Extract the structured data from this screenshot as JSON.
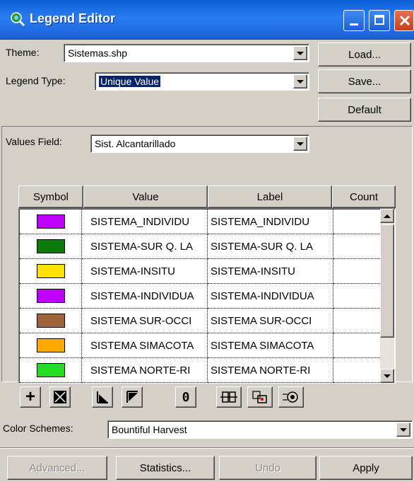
{
  "window": {
    "title": "Legend Editor"
  },
  "theme": {
    "label": "Theme:",
    "value": "Sistemas.shp"
  },
  "legend_type": {
    "label": "Legend Type:",
    "value": "Unique Value"
  },
  "side_buttons": {
    "load": "Load...",
    "save": "Save...",
    "default": "Default"
  },
  "values_field": {
    "label": "Values Field:",
    "value": "Sist. Alcantarillado"
  },
  "table": {
    "headers": [
      "Symbol",
      "Value",
      "Label",
      "Count"
    ],
    "rows": [
      {
        "color": "#c000ff",
        "value": "SISTEMA_INDIVIDU",
        "label": "SISTEMA_INDIVIDU",
        "count": ""
      },
      {
        "color": "#0a7a0a",
        "value": "SISTEMA-SUR Q. LA",
        "label": "SISTEMA-SUR Q. LA",
        "count": ""
      },
      {
        "color": "#ffe000",
        "value": "SISTEMA-INSITU",
        "label": "SISTEMA-INSITU",
        "count": ""
      },
      {
        "color": "#c000ff",
        "value": "SISTEMA-INDIVIDUA",
        "label": "SISTEMA-INDIVIDUA",
        "count": ""
      },
      {
        "color": "#a0643c",
        "value": "SISTEMA SUR-OCCI",
        "label": "SISTEMA SUR-OCCI",
        "count": ""
      },
      {
        "color": "#ffa800",
        "value": "SISTEMA SIMACOTA",
        "label": "SISTEMA SIMACOTA",
        "count": ""
      },
      {
        "color": "#22dd22",
        "value": "SISTEMA NORTE-RI",
        "label": "SISTEMA NORTE-RI",
        "count": ""
      }
    ]
  },
  "toolbar": {
    "add": "+",
    "zero": "0",
    "icons": [
      "add-icon",
      "delete-icon",
      "sort-ascending-icon",
      "sort-descending-icon",
      "zero-icon",
      "move-icon",
      "copy-icon",
      "reverse-icon"
    ]
  },
  "color_schemes": {
    "label": "Color Schemes:",
    "value": "Bountiful Harvest"
  },
  "bottom_buttons": {
    "advanced": "Advanced...",
    "statistics": "Statistics...",
    "undo": "Undo",
    "apply": "Apply"
  }
}
